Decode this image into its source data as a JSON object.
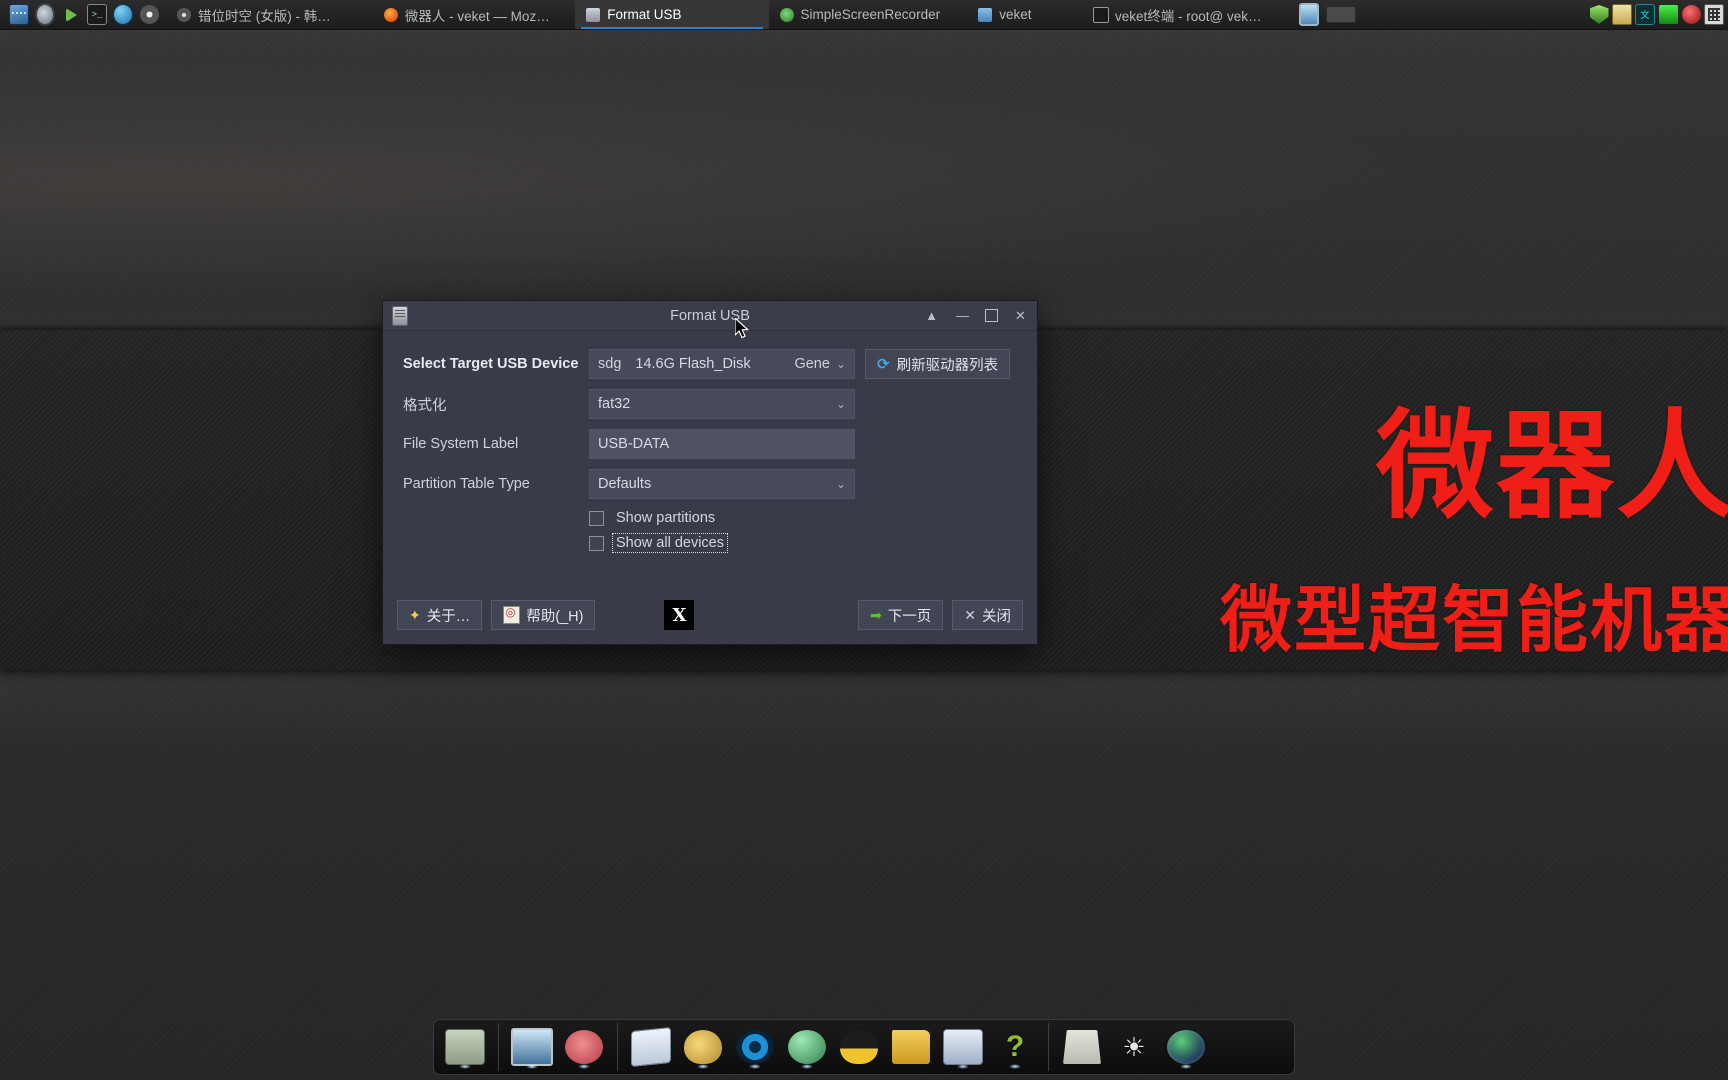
{
  "taskbar": {
    "launchers": [
      {
        "name": "system-monitor-icon",
        "glyph": "chip-graph"
      },
      {
        "name": "settings-gear-icon",
        "glyph": "chip-gear"
      },
      {
        "name": "media-play-icon",
        "glyph": "chip-play"
      },
      {
        "name": "terminal-icon",
        "glyph": "chip-term"
      },
      {
        "name": "browser-globe-icon",
        "glyph": "chip-globe"
      },
      {
        "name": "disc-icon",
        "glyph": "chip-disc"
      }
    ],
    "tasks": [
      {
        "label": "错位时空 (女版) - 韩…",
        "icon": "media-disc-icon",
        "active": false
      },
      {
        "label": "微器人 - veket — Moz…",
        "icon": "firefox-icon",
        "active": false
      },
      {
        "label": "Format USB",
        "icon": "format-usb-icon",
        "active": true
      },
      {
        "label": "SimpleScreenRecorder",
        "icon": "screen-recorder-icon",
        "active": false
      },
      {
        "label": "veket",
        "icon": "folder-icon",
        "active": false
      },
      {
        "label": "veket终端 - root@ vek…",
        "icon": "terminal-icon",
        "active": false
      }
    ],
    "tray": [
      {
        "name": "display-monitor-icon",
        "glyph": "chip-mon"
      },
      {
        "name": "blank-panel-icon",
        "glyph": "chip-blank"
      },
      {
        "name": "shield-icon",
        "glyph": "chip-shield"
      },
      {
        "name": "clipboard-icon",
        "glyph": "chip-clip"
      },
      {
        "name": "input-method-icon",
        "glyph": "chip-cyan",
        "text": "文"
      },
      {
        "name": "battery-icon",
        "glyph": "chip-batt"
      },
      {
        "name": "record-icon",
        "glyph": "chip-red"
      },
      {
        "name": "keyboard-icon",
        "glyph": "chip-kb"
      }
    ]
  },
  "dialog": {
    "title": "Format USB",
    "window_buttons": [
      {
        "name": "shade-button",
        "glyph": "▲"
      },
      {
        "name": "minimize-button",
        "glyph": "—"
      },
      {
        "name": "maximize-button",
        "glyph": ""
      },
      {
        "name": "close-button",
        "glyph": "✕"
      }
    ],
    "fields": {
      "device_label": "Select Target USB Device",
      "device_name": "sdg",
      "device_size_model": "14.6G Flash_Disk",
      "device_vendor": "Gene",
      "refresh_label": "刷新驱动器列表",
      "format_label": "格式化",
      "format_value": "fat32",
      "fs_label_label": "File System Label",
      "fs_label_value": "USB-DATA",
      "parttable_label": "Partition Table Type",
      "parttable_value": "Defaults"
    },
    "checkboxes": [
      {
        "label": "Show partitions",
        "checked": false,
        "focused": false
      },
      {
        "label": "Show all devices",
        "checked": false,
        "focused": true
      }
    ],
    "footer": {
      "about_label": "关于…",
      "help_label": "帮助(_H)",
      "logo_text": "X",
      "next_label": "下一页",
      "close_label": "关闭"
    }
  },
  "wallpaper": {
    "title": "微器人",
    "subtitle": "微型超智能机器",
    "accent_color": "#ef1f17"
  },
  "dock": {
    "items": [
      {
        "name": "dock-file-manager",
        "glyph": "d-files",
        "lit": true
      },
      {
        "sep": true
      },
      {
        "name": "dock-desktop-settings",
        "glyph": "d-mon",
        "lit": true
      },
      {
        "name": "dock-pet-app",
        "glyph": "d-pig",
        "lit": true
      },
      {
        "sep": true
      },
      {
        "name": "dock-text-editor",
        "glyph": "d-note",
        "lit": false
      },
      {
        "name": "dock-paint",
        "glyph": "d-paint",
        "lit": true
      },
      {
        "name": "dock-media-player",
        "glyph": "d-disc",
        "lit": true
      },
      {
        "name": "dock-network",
        "glyph": "d-net",
        "lit": true
      },
      {
        "name": "dock-linux-apps",
        "glyph": "d-tux",
        "lit": false
      },
      {
        "name": "dock-documents",
        "glyph": "d-fold",
        "lit": false
      },
      {
        "name": "dock-office",
        "glyph": "d-chart",
        "lit": true
      },
      {
        "name": "dock-help",
        "glyph": "d-help",
        "lit": true,
        "text": "?"
      },
      {
        "sep": true
      },
      {
        "name": "dock-show-desktop",
        "glyph": "d-desk",
        "lit": false
      },
      {
        "name": "dock-brightness",
        "glyph": "d-sun",
        "lit": false,
        "text": "☀"
      },
      {
        "name": "dock-web-browser",
        "glyph": "d-orb",
        "lit": true
      }
    ]
  }
}
